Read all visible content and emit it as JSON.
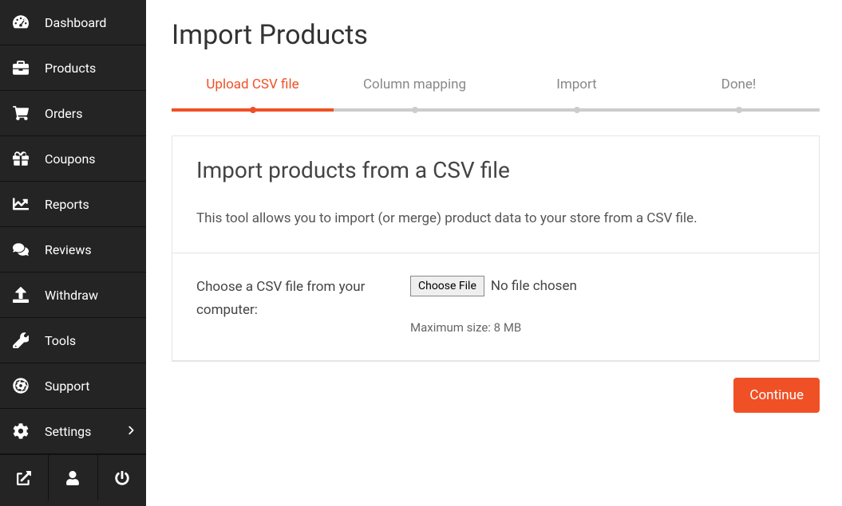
{
  "sidebar": {
    "items": [
      {
        "label": "Dashboard"
      },
      {
        "label": "Products"
      },
      {
        "label": "Orders"
      },
      {
        "label": "Coupons"
      },
      {
        "label": "Reports"
      },
      {
        "label": "Reviews"
      },
      {
        "label": "Withdraw"
      },
      {
        "label": "Tools"
      },
      {
        "label": "Support"
      },
      {
        "label": "Settings"
      }
    ]
  },
  "page": {
    "title": "Import Products"
  },
  "steps": [
    {
      "label": "Upload CSV file",
      "active": true
    },
    {
      "label": "Column mapping",
      "active": false
    },
    {
      "label": "Import",
      "active": false
    },
    {
      "label": "Done!",
      "active": false
    }
  ],
  "card": {
    "title": "Import products from a CSV file",
    "desc": "This tool allows you to import (or merge) product data to your store from a CSV file."
  },
  "form": {
    "file_label": "Choose a CSV file from your computer:",
    "file_button": "Choose File",
    "file_status": "No file chosen",
    "file_hint": "Maximum size: 8 MB"
  },
  "actions": {
    "continue": "Continue"
  }
}
